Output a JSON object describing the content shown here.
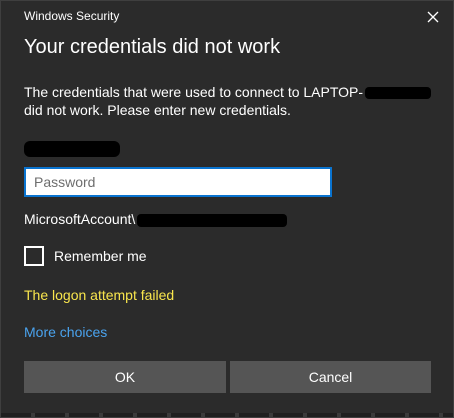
{
  "window": {
    "title": "Windows Security",
    "close_icon": "close-icon"
  },
  "dialog": {
    "heading": "Your credentials did not work",
    "description": "The credentials that were used to connect to LAPTOP-",
    "description_end": "did not work. Please enter new credentials."
  },
  "password": {
    "placeholder": "Password",
    "value": ""
  },
  "account": {
    "prefix": "MicrosoftAccount\\"
  },
  "remember": {
    "label": "Remember me",
    "checked": false
  },
  "status": {
    "error": "The logon attempt failed",
    "error_color": "#f9e64d"
  },
  "links": {
    "more_choices": "More choices",
    "link_color": "#4aa3ee"
  },
  "buttons": {
    "ok": "OK",
    "cancel": "Cancel"
  },
  "colors": {
    "background": "#2b2b2b",
    "button": "#555555",
    "input_border": "#0a74d0"
  }
}
